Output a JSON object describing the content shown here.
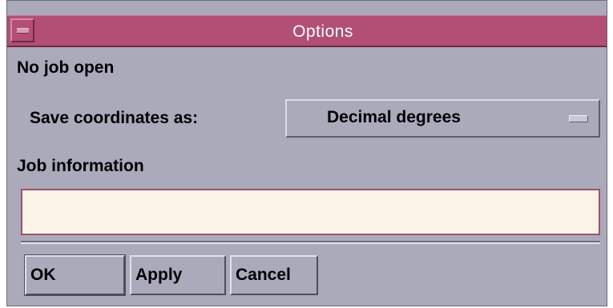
{
  "window": {
    "title": "Options"
  },
  "status": {
    "job_text": "No job open"
  },
  "coordinates": {
    "label": "Save coordinates as:",
    "selected": "Decimal degrees"
  },
  "job_info": {
    "label": "Job information",
    "value": ""
  },
  "buttons": {
    "ok": "OK",
    "apply": "Apply",
    "cancel": "Cancel"
  },
  "colors": {
    "titlebar": "#b24f72",
    "window_bg": "#aaaabb",
    "field_bg": "#fdf4e8"
  }
}
